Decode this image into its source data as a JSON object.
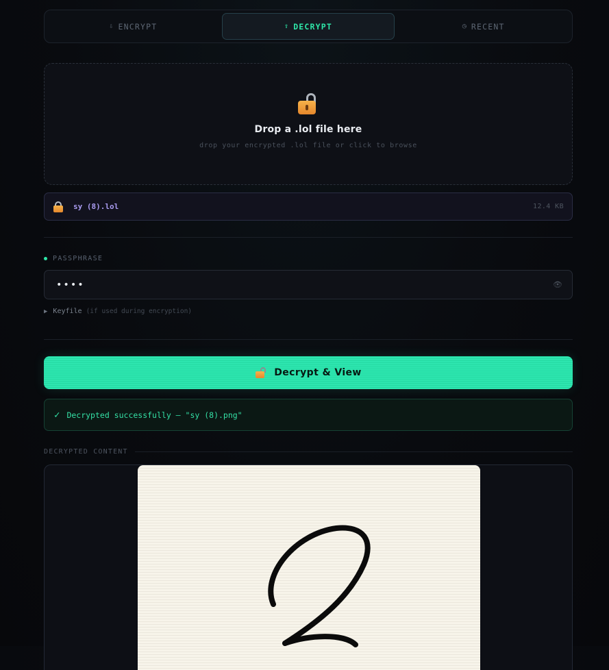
{
  "tabs": [
    {
      "icon": "⇩",
      "label": "ENCRYPT"
    },
    {
      "icon": "⇧",
      "label": "DECRYPT"
    },
    {
      "icon": "◷",
      "label": "RECENT"
    }
  ],
  "dropzone": {
    "title": "Drop a .lol file here",
    "subtitle": "drop your encrypted .lol file or click to browse"
  },
  "file": {
    "name": "sy (8).lol",
    "size": "12.4 KB"
  },
  "passphrase": {
    "label": "PASSPHRASE",
    "value": "••••",
    "eye_icon": "👁"
  },
  "keyfile": {
    "arrow": "▶",
    "label": "Keyfile",
    "hint": "(if used during encryption)"
  },
  "decrypt_button": {
    "label": "Decrypt & View"
  },
  "success": {
    "check": "✓",
    "message": "Decrypted successfully — \"sy (8).png\""
  },
  "content_section": {
    "title": "DECRYPTED CONTENT"
  },
  "colors": {
    "accent": "#2ee6a8",
    "file_name": "#a99bf0",
    "background": "#090b0f"
  }
}
